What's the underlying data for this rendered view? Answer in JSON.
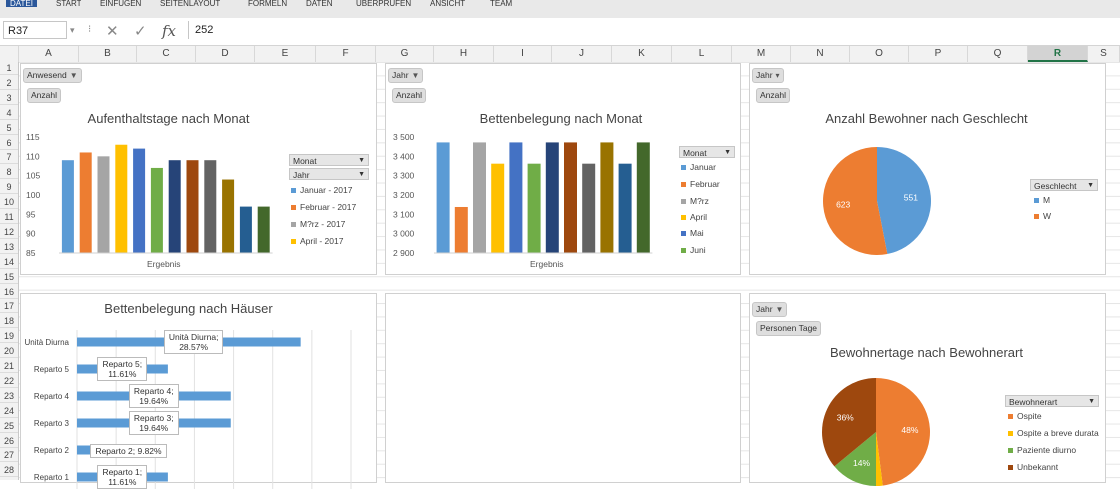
{
  "ribbon": {
    "tabs": [
      {
        "label": "DATEI",
        "active": true
      },
      {
        "label": "START"
      },
      {
        "label": "EINFÜGEN"
      },
      {
        "label": "SEITENLAYOUT"
      },
      {
        "label": "FORMELN"
      },
      {
        "label": "DATEN"
      },
      {
        "label": "ÜBERPRÜFEN"
      },
      {
        "label": "ANSICHT"
      },
      {
        "label": "TEAM"
      }
    ]
  },
  "formula_bar": {
    "name_box": "R37",
    "cancel": "✕",
    "confirm": "✓",
    "fx": "fx",
    "value": "252"
  },
  "columns": [
    "A",
    "B",
    "C",
    "D",
    "E",
    "F",
    "G",
    "H",
    "I",
    "J",
    "K",
    "L",
    "M",
    "N",
    "O",
    "P",
    "Q",
    "R",
    "S"
  ],
  "selected_column": "R",
  "rows": [
    "1",
    "2",
    "3",
    "4",
    "5",
    "6",
    "7",
    "8",
    "9",
    "10",
    "11",
    "12",
    "13",
    "14",
    "15",
    "16",
    "17",
    "18",
    "19",
    "20",
    "21",
    "22",
    "23",
    "24",
    "25",
    "26",
    "27",
    "28"
  ],
  "panels": {
    "p1": {
      "filter_btn": "Anwesend",
      "value_btn": "Anzahl",
      "title": "Aufenthaltstage nach Monat",
      "xlabel": "Ergebnis",
      "field_monat": "Monat",
      "field_jahr": "Jahr",
      "legend": [
        "Januar - 2017",
        "Februar - 2017",
        "M?rz - 2017",
        "April - 2017"
      ]
    },
    "p2": {
      "filter_btn": "Jahr",
      "value_btn": "Anzahl",
      "title": "Bettenbelegung nach Monat",
      "xlabel": "Ergebnis",
      "field": "Monat",
      "legend": [
        "Januar",
        "Februar",
        "M?rz",
        "April",
        "Mai",
        "Juni"
      ]
    },
    "p3": {
      "filter_btn": "Jahr",
      "value_btn": "Anzahl",
      "title": "Anzahl Bewohner nach Geschlecht",
      "field": "Geschlecht",
      "legend": [
        "M",
        "W"
      ]
    },
    "p4": {
      "title": "Bettenbelegung nach Häuser"
    },
    "p6": {
      "filter_btn": "Jahr",
      "value_btn": "Personen Tage",
      "title": "Bewohnertage nach Bewohnerart",
      "field": "Bewohnerart",
      "legend": [
        "Ospite",
        "Ospite a breve durata",
        "Paziente diurno",
        "Unbekannt"
      ]
    }
  },
  "chart_data": [
    {
      "type": "bar",
      "title": "Aufenthaltstage nach Monat",
      "xlabel": "Ergebnis",
      "ylim": [
        85,
        115
      ],
      "yticks": [
        "85",
        "90",
        "95",
        "100",
        "105",
        "110",
        "115"
      ],
      "colors": [
        "#5b9bd5",
        "#ed7d31",
        "#a5a5a5",
        "#ffc000",
        "#4472c4",
        "#70ad47",
        "#264478",
        "#9e480e",
        "#636363",
        "#997300",
        "#255e91",
        "#43682b"
      ],
      "values": [
        109,
        111,
        110,
        113,
        112,
        107,
        109,
        109,
        109,
        104,
        97,
        97
      ]
    },
    {
      "type": "bar",
      "title": "Bettenbelegung nach Monat",
      "xlabel": "Ergebnis",
      "ylim": [
        2900,
        3500
      ],
      "yticks": [
        "2 900",
        "3 000",
        "3 100",
        "3 200",
        "3 300",
        "3 400",
        "3 500"
      ],
      "colors": [
        "#5b9bd5",
        "#ed7d31",
        "#a5a5a5",
        "#ffc000",
        "#4472c4",
        "#70ad47",
        "#264478",
        "#9e480e",
        "#636363",
        "#997300",
        "#255e91",
        "#43682b"
      ],
      "values": [
        3472,
        3138,
        3472,
        3362,
        3472,
        3362,
        3472,
        3472,
        3362,
        3472,
        3362,
        3472
      ]
    },
    {
      "type": "pie",
      "title": "Anzahl Bewohner nach Geschlecht",
      "series": [
        {
          "name": "M",
          "value": 551,
          "color": "#5b9bd5"
        },
        {
          "name": "W",
          "value": 623,
          "color": "#ed7d31"
        }
      ]
    },
    {
      "type": "bar",
      "orientation": "horizontal",
      "title": "Bettenbelegung nach Häuser",
      "xlim": [
        0,
        0.35
      ],
      "categories": [
        "Unità Diurna",
        "Reparto 5",
        "Reparto 4",
        "Reparto 3",
        "Reparto 2",
        "Reparto 1"
      ],
      "values": [
        0.2857,
        0.1161,
        0.1964,
        0.1964,
        0.0982,
        0.1161
      ],
      "labels": [
        "Unità Diurna;\n28.57%",
        "Reparto 5;\n11.61%",
        "Reparto 4;\n19.64%",
        "Reparto 3;\n19.64%",
        "Reparto 2; 9.82%",
        "Reparto 1;\n11.61%"
      ],
      "color": "#5b9bd5"
    },
    {
      "type": "pie",
      "title": "Bewohnertage nach Bewohnerart",
      "series": [
        {
          "name": "Ospite",
          "value": 48,
          "label": "48%",
          "color": "#ed7d31"
        },
        {
          "name": "Ospite a breve durata",
          "value": 2,
          "label": "",
          "color": "#ffc000"
        },
        {
          "name": "Paziente diurno",
          "value": 14,
          "label": "14%",
          "color": "#70ad47"
        },
        {
          "name": "Unbekannt",
          "value": 36,
          "label": "36%",
          "color": "#9e480e"
        }
      ]
    }
  ]
}
